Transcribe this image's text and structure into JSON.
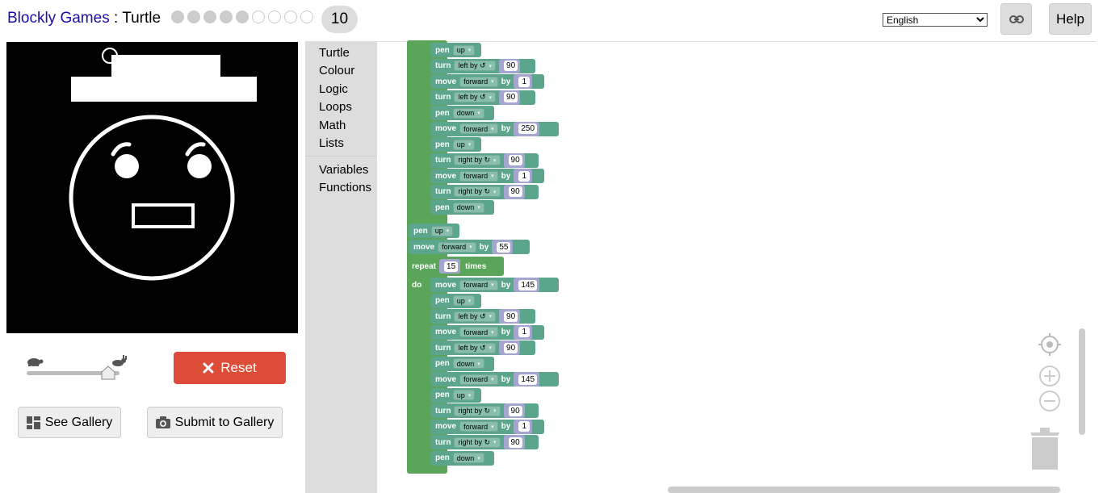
{
  "header": {
    "brand": "Blockly Games",
    "separator": " : ",
    "game": "Turtle",
    "level": "10",
    "levels_total": 10,
    "levels_completed": 5,
    "language": "English",
    "help_label": "Help"
  },
  "controls": {
    "reset_label": "Reset",
    "see_gallery_label": "See Gallery",
    "submit_gallery_label": "Submit to Gallery",
    "speed": 0.88
  },
  "toolbox": {
    "items": [
      "Turtle",
      "Colour",
      "Logic",
      "Loops",
      "Math",
      "Lists",
      "Variables",
      "Functions"
    ]
  },
  "words": {
    "pen": "pen",
    "turn": "turn",
    "move": "move",
    "by": "by",
    "repeat": "repeat",
    "times": "times",
    "do": "do"
  },
  "options": {
    "up": "up",
    "down": "down",
    "forward": "forward",
    "left": "left by ↺",
    "right": "right by ↻"
  },
  "program": {
    "group1": [
      {
        "kind": "pen",
        "opt": "up"
      },
      {
        "kind": "turn",
        "opt": "left",
        "val": "90"
      },
      {
        "kind": "move",
        "opt": "forward",
        "val": "1"
      },
      {
        "kind": "turn",
        "opt": "left",
        "val": "90"
      },
      {
        "kind": "pen",
        "opt": "down"
      },
      {
        "kind": "move",
        "opt": "forward",
        "val": "250"
      },
      {
        "kind": "pen",
        "opt": "up"
      },
      {
        "kind": "turn",
        "opt": "right",
        "val": "90"
      },
      {
        "kind": "move",
        "opt": "forward",
        "val": "1"
      },
      {
        "kind": "turn",
        "opt": "right",
        "val": "90"
      },
      {
        "kind": "pen",
        "opt": "down"
      }
    ],
    "mid": [
      {
        "kind": "pen",
        "opt": "up"
      },
      {
        "kind": "move",
        "opt": "forward",
        "val": "55"
      }
    ],
    "repeat_times": "15",
    "group2": [
      {
        "kind": "move",
        "opt": "forward",
        "val": "145"
      },
      {
        "kind": "pen",
        "opt": "up"
      },
      {
        "kind": "turn",
        "opt": "left",
        "val": "90"
      },
      {
        "kind": "move",
        "opt": "forward",
        "val": "1"
      },
      {
        "kind": "turn",
        "opt": "left",
        "val": "90"
      },
      {
        "kind": "pen",
        "opt": "down"
      },
      {
        "kind": "move",
        "opt": "forward",
        "val": "145"
      },
      {
        "kind": "pen",
        "opt": "up"
      },
      {
        "kind": "turn",
        "opt": "right",
        "val": "90"
      },
      {
        "kind": "move",
        "opt": "forward",
        "val": "1"
      },
      {
        "kind": "turn",
        "opt": "right",
        "val": "90"
      },
      {
        "kind": "pen",
        "opt": "down"
      }
    ]
  },
  "colors": {
    "turtle_block": "#5ba58c",
    "loop_block": "#5ba55b",
    "math_block": "#a5a5d2",
    "reset": "#dd4b39"
  }
}
